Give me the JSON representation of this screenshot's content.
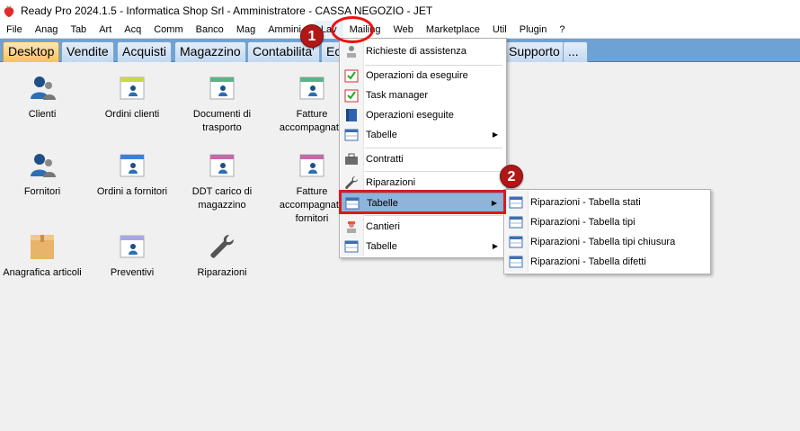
{
  "window": {
    "title": "Ready Pro 2024.1.5 - Informatica Shop Srl - Amministratore - CASSA NEGOZIO - JET"
  },
  "menubar": {
    "items": [
      {
        "label": "File"
      },
      {
        "label": "Anag"
      },
      {
        "label": "Tab"
      },
      {
        "label": "Art"
      },
      {
        "label": "Acq"
      },
      {
        "label": "Comm"
      },
      {
        "label": "Banco"
      },
      {
        "label": "Mag"
      },
      {
        "label": "Ammini"
      },
      {
        "label": "Lav"
      },
      {
        "label": "Mailing"
      },
      {
        "label": "Web"
      },
      {
        "label": "Marketplace"
      },
      {
        "label": "Util"
      },
      {
        "label": "Plugin"
      },
      {
        "label": "?"
      }
    ]
  },
  "tabs": [
    {
      "label": "Desktop",
      "active": true
    },
    {
      "label": "Vendite"
    },
    {
      "label": "Acquisti"
    },
    {
      "label": "Magazzino"
    },
    {
      "label": "Contabilita'"
    },
    {
      "label": "Ec"
    },
    {
      "label": "Supporto"
    },
    {
      "label": "..."
    }
  ],
  "desktop": {
    "icons": [
      {
        "label": "Clienti",
        "icon": "clients-icon"
      },
      {
        "label": "Ordini clienti",
        "icon": "customer-orders-icon"
      },
      {
        "label": "Documenti di trasporto",
        "icon": "transport-docs-icon"
      },
      {
        "label": "Fatture accompagnato",
        "icon": "invoices-icon"
      },
      {
        "label": "Fornitori",
        "icon": "suppliers-icon"
      },
      {
        "label": "Ordini a fornitori",
        "icon": "supplier-orders-icon"
      },
      {
        "label": "DDT carico di magazzino",
        "icon": "ddt-icon"
      },
      {
        "label": "Fatture accompagnato fornitori",
        "icon": "supplier-invoices-icon"
      },
      {
        "label": "Anagrafica articoli",
        "icon": "box-icon"
      },
      {
        "label": "Preventivi",
        "icon": "quotes-icon"
      },
      {
        "label": "Riparazioni",
        "icon": "wrench-icon"
      }
    ]
  },
  "lav_menu": {
    "items": [
      {
        "label": "Richieste di assistenza",
        "icon": "support-request-icon"
      },
      {
        "label": "Operazioni da eseguire",
        "icon": "todo-icon"
      },
      {
        "label": "Task manager",
        "icon": "task-icon"
      },
      {
        "label": "Operazioni eseguite",
        "icon": "book-icon"
      },
      {
        "label": "Tabelle",
        "icon": "table-icon",
        "submenu": true
      },
      {
        "label": "Contratti",
        "icon": "briefcase-icon"
      },
      {
        "label": "Riparazioni",
        "icon": "wrench-icon"
      },
      {
        "label": "Tabelle",
        "icon": "table-icon",
        "submenu": true,
        "highlighted": true
      },
      {
        "label": "Cantieri",
        "icon": "worker-icon"
      },
      {
        "label": "Tabelle",
        "icon": "table-icon",
        "submenu": true
      }
    ]
  },
  "sub_menu": {
    "items": [
      {
        "label": "Riparazioni - Tabella stati"
      },
      {
        "label": "Riparazioni - Tabella tipi"
      },
      {
        "label": "Riparazioni - Tabella tipi chiusura"
      },
      {
        "label": "Riparazioni - Tabella difetti"
      }
    ]
  },
  "annotations": {
    "step1": "1",
    "step2": "2"
  },
  "colors": {
    "tabbar": "#6ea2d4",
    "active_tab": "#f7c263",
    "highlight": "#8fb3d9",
    "annotation_red": "#d81b1b"
  }
}
